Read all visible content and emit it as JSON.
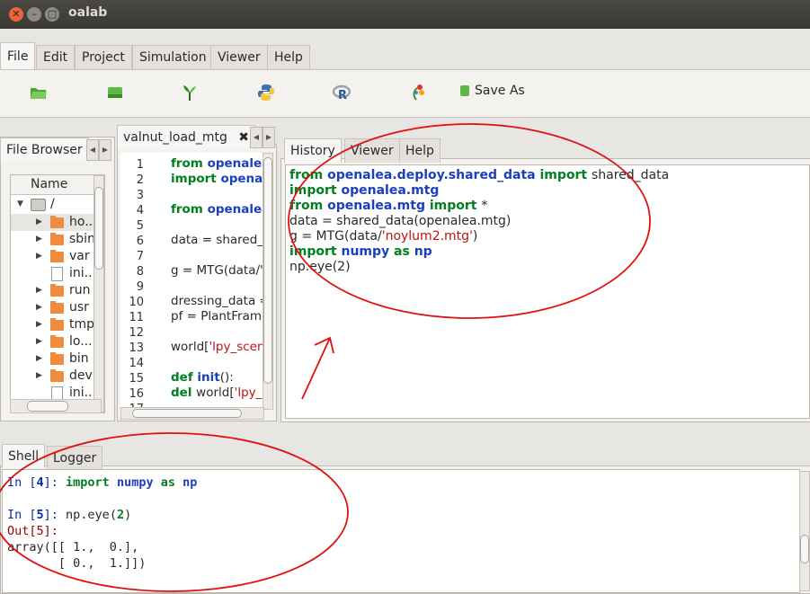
{
  "window": {
    "title": "oalab"
  },
  "menu": {
    "tabs": [
      "File",
      "Edit",
      "Project",
      "Simulation",
      "Viewer",
      "Help"
    ]
  },
  "ribbon": {
    "icons": [
      "open-folder-icon",
      "save-drive-icon",
      "openalea-plant-icon",
      "python-icon",
      "r-language-icon",
      "lpy-icon"
    ],
    "save_as_label": "Save As"
  },
  "left_panel": {
    "tab_label": "File Browser",
    "tree_header": "Name",
    "root": "/",
    "items": [
      {
        "label": "ho...",
        "type": "folder",
        "selected": true
      },
      {
        "label": "sbin",
        "type": "folder"
      },
      {
        "label": "var",
        "type": "folder"
      },
      {
        "label": "ini...",
        "type": "file"
      },
      {
        "label": "run",
        "type": "folder"
      },
      {
        "label": "usr",
        "type": "folder"
      },
      {
        "label": "tmp",
        "type": "folder"
      },
      {
        "label": "lo...",
        "type": "folder"
      },
      {
        "label": "bin",
        "type": "folder"
      },
      {
        "label": "dev",
        "type": "folder"
      },
      {
        "label": "ini...",
        "type": "file"
      }
    ]
  },
  "editor": {
    "tab_label": "valnut_load_mtg",
    "line_numbers": [
      "1",
      "2",
      "3",
      "4",
      "5",
      "6",
      "7",
      "8",
      "9",
      "10",
      "11",
      "12",
      "13",
      "14",
      "15",
      "16",
      "17"
    ],
    "lines": [
      {
        "n": 1,
        "parts": [
          {
            "t": "from ",
            "c": "kw"
          },
          {
            "t": "openalea",
            "c": "nm"
          }
        ]
      },
      {
        "n": 2,
        "parts": [
          {
            "t": "import ",
            "c": "kw"
          },
          {
            "t": "openale",
            "c": "nm"
          }
        ]
      },
      {
        "n": 4,
        "parts": [
          {
            "t": "from ",
            "c": "kw"
          },
          {
            "t": "openalea",
            "c": "nm"
          }
        ]
      },
      {
        "n": 6,
        "parts": [
          {
            "t": "data = shared_c",
            "c": ""
          }
        ]
      },
      {
        "n": 8,
        "parts": [
          {
            "t": "g = MTG(data/'",
            "c": ""
          },
          {
            "t": "n",
            "c": "str"
          }
        ]
      },
      {
        "n": 10,
        "parts": [
          {
            "t": "dressing_data =",
            "c": ""
          }
        ]
      },
      {
        "n": 11,
        "parts": [
          {
            "t": "pf = PlantFrame",
            "c": ""
          }
        ]
      },
      {
        "n": 13,
        "parts": [
          {
            "t": "world[",
            "c": ""
          },
          {
            "t": "'lpy_scen",
            "c": "str"
          }
        ]
      },
      {
        "n": 15,
        "parts": [
          {
            "t": "def ",
            "c": "kw"
          },
          {
            "t": "init",
            "c": "nm"
          },
          {
            "t": "():",
            "c": ""
          }
        ]
      },
      {
        "n": 16,
        "parts": [
          {
            "t": " del ",
            "c": "kw"
          },
          {
            "t": "world[",
            "c": ""
          },
          {
            "t": "'lpy_",
            "c": "str"
          }
        ]
      }
    ]
  },
  "right_panel": {
    "tabs": [
      "History",
      "Viewer",
      "Help"
    ],
    "history_lines": [
      [
        {
          "t": "from ",
          "c": "kw"
        },
        {
          "t": "openalea.deploy.shared_data ",
          "c": "nm"
        },
        {
          "t": "import ",
          "c": "kw"
        },
        {
          "t": "shared_data",
          "c": ""
        }
      ],
      [
        {
          "t": "import ",
          "c": "kw"
        },
        {
          "t": "openalea.mtg",
          "c": "nm"
        }
      ],
      [
        {
          "t": "from ",
          "c": "kw"
        },
        {
          "t": "openalea.mtg ",
          "c": "nm"
        },
        {
          "t": "import ",
          "c": "kw"
        },
        {
          "t": "*",
          "c": ""
        }
      ],
      [
        {
          "t": "data = shared_data(openalea.mtg)",
          "c": ""
        }
      ],
      [
        {
          "t": "g = MTG(data/",
          "c": ""
        },
        {
          "t": "'noylum2.mtg'",
          "c": "str"
        },
        {
          "t": ")",
          "c": ""
        }
      ],
      [
        {
          "t": "import ",
          "c": "kw"
        },
        {
          "t": "numpy ",
          "c": "nm"
        },
        {
          "t": "as ",
          "c": "kw"
        },
        {
          "t": "np",
          "c": "nm"
        }
      ],
      [
        {
          "t": "np.eye(2)",
          "c": ""
        }
      ]
    ]
  },
  "bottom_panel": {
    "tabs": [
      "Shell",
      "Logger"
    ],
    "shell_lines": [
      {
        "prompt": "In [",
        "num": "4",
        "close": "]: ",
        "code": [
          {
            "t": "import ",
            "c": "kw"
          },
          {
            "t": "numpy ",
            "c": "nm"
          },
          {
            "t": "as ",
            "c": "kw"
          },
          {
            "t": "np",
            "c": "nm"
          }
        ]
      },
      {
        "blank": true
      },
      {
        "prompt": "In [",
        "num": "5",
        "close": "]: ",
        "code": [
          {
            "t": "np.eye(",
            "c": ""
          },
          {
            "t": "2",
            "c": "num"
          },
          {
            "t": ")",
            "c": ""
          }
        ]
      },
      {
        "out": "Out[5]:"
      },
      {
        "text": "array([[ 1.,  0.],"
      },
      {
        "text": "       [ 0.,  1.]])"
      }
    ]
  },
  "colors": {
    "annotation": "#e01010",
    "keyword": "#00801f",
    "name": "#1a3fbf",
    "string": "#c01010"
  }
}
